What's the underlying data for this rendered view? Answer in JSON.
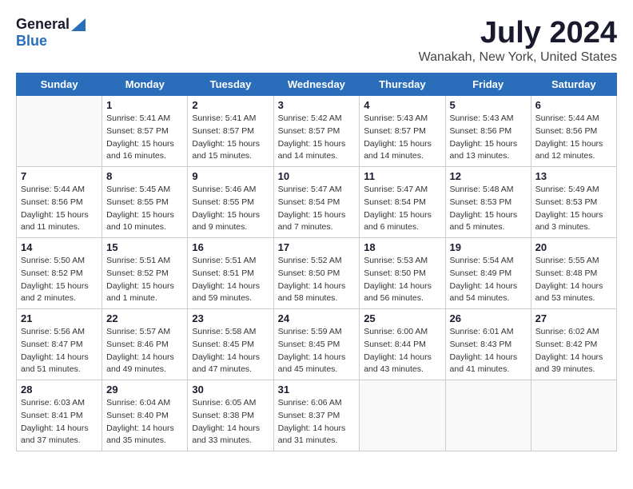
{
  "logo": {
    "general": "General",
    "blue": "Blue"
  },
  "title": "July 2024",
  "subtitle": "Wanakah, New York, United States",
  "header_days": [
    "Sunday",
    "Monday",
    "Tuesday",
    "Wednesday",
    "Thursday",
    "Friday",
    "Saturday"
  ],
  "weeks": [
    [
      {
        "day": "",
        "info": ""
      },
      {
        "day": "1",
        "info": "Sunrise: 5:41 AM\nSunset: 8:57 PM\nDaylight: 15 hours\nand 16 minutes."
      },
      {
        "day": "2",
        "info": "Sunrise: 5:41 AM\nSunset: 8:57 PM\nDaylight: 15 hours\nand 15 minutes."
      },
      {
        "day": "3",
        "info": "Sunrise: 5:42 AM\nSunset: 8:57 PM\nDaylight: 15 hours\nand 14 minutes."
      },
      {
        "day": "4",
        "info": "Sunrise: 5:43 AM\nSunset: 8:57 PM\nDaylight: 15 hours\nand 14 minutes."
      },
      {
        "day": "5",
        "info": "Sunrise: 5:43 AM\nSunset: 8:56 PM\nDaylight: 15 hours\nand 13 minutes."
      },
      {
        "day": "6",
        "info": "Sunrise: 5:44 AM\nSunset: 8:56 PM\nDaylight: 15 hours\nand 12 minutes."
      }
    ],
    [
      {
        "day": "7",
        "info": "Sunrise: 5:44 AM\nSunset: 8:56 PM\nDaylight: 15 hours\nand 11 minutes."
      },
      {
        "day": "8",
        "info": "Sunrise: 5:45 AM\nSunset: 8:55 PM\nDaylight: 15 hours\nand 10 minutes."
      },
      {
        "day": "9",
        "info": "Sunrise: 5:46 AM\nSunset: 8:55 PM\nDaylight: 15 hours\nand 9 minutes."
      },
      {
        "day": "10",
        "info": "Sunrise: 5:47 AM\nSunset: 8:54 PM\nDaylight: 15 hours\nand 7 minutes."
      },
      {
        "day": "11",
        "info": "Sunrise: 5:47 AM\nSunset: 8:54 PM\nDaylight: 15 hours\nand 6 minutes."
      },
      {
        "day": "12",
        "info": "Sunrise: 5:48 AM\nSunset: 8:53 PM\nDaylight: 15 hours\nand 5 minutes."
      },
      {
        "day": "13",
        "info": "Sunrise: 5:49 AM\nSunset: 8:53 PM\nDaylight: 15 hours\nand 3 minutes."
      }
    ],
    [
      {
        "day": "14",
        "info": "Sunrise: 5:50 AM\nSunset: 8:52 PM\nDaylight: 15 hours\nand 2 minutes."
      },
      {
        "day": "15",
        "info": "Sunrise: 5:51 AM\nSunset: 8:52 PM\nDaylight: 15 hours\nand 1 minute."
      },
      {
        "day": "16",
        "info": "Sunrise: 5:51 AM\nSunset: 8:51 PM\nDaylight: 14 hours\nand 59 minutes."
      },
      {
        "day": "17",
        "info": "Sunrise: 5:52 AM\nSunset: 8:50 PM\nDaylight: 14 hours\nand 58 minutes."
      },
      {
        "day": "18",
        "info": "Sunrise: 5:53 AM\nSunset: 8:50 PM\nDaylight: 14 hours\nand 56 minutes."
      },
      {
        "day": "19",
        "info": "Sunrise: 5:54 AM\nSunset: 8:49 PM\nDaylight: 14 hours\nand 54 minutes."
      },
      {
        "day": "20",
        "info": "Sunrise: 5:55 AM\nSunset: 8:48 PM\nDaylight: 14 hours\nand 53 minutes."
      }
    ],
    [
      {
        "day": "21",
        "info": "Sunrise: 5:56 AM\nSunset: 8:47 PM\nDaylight: 14 hours\nand 51 minutes."
      },
      {
        "day": "22",
        "info": "Sunrise: 5:57 AM\nSunset: 8:46 PM\nDaylight: 14 hours\nand 49 minutes."
      },
      {
        "day": "23",
        "info": "Sunrise: 5:58 AM\nSunset: 8:45 PM\nDaylight: 14 hours\nand 47 minutes."
      },
      {
        "day": "24",
        "info": "Sunrise: 5:59 AM\nSunset: 8:45 PM\nDaylight: 14 hours\nand 45 minutes."
      },
      {
        "day": "25",
        "info": "Sunrise: 6:00 AM\nSunset: 8:44 PM\nDaylight: 14 hours\nand 43 minutes."
      },
      {
        "day": "26",
        "info": "Sunrise: 6:01 AM\nSunset: 8:43 PM\nDaylight: 14 hours\nand 41 minutes."
      },
      {
        "day": "27",
        "info": "Sunrise: 6:02 AM\nSunset: 8:42 PM\nDaylight: 14 hours\nand 39 minutes."
      }
    ],
    [
      {
        "day": "28",
        "info": "Sunrise: 6:03 AM\nSunset: 8:41 PM\nDaylight: 14 hours\nand 37 minutes."
      },
      {
        "day": "29",
        "info": "Sunrise: 6:04 AM\nSunset: 8:40 PM\nDaylight: 14 hours\nand 35 minutes."
      },
      {
        "day": "30",
        "info": "Sunrise: 6:05 AM\nSunset: 8:38 PM\nDaylight: 14 hours\nand 33 minutes."
      },
      {
        "day": "31",
        "info": "Sunrise: 6:06 AM\nSunset: 8:37 PM\nDaylight: 14 hours\nand 31 minutes."
      },
      {
        "day": "",
        "info": ""
      },
      {
        "day": "",
        "info": ""
      },
      {
        "day": "",
        "info": ""
      }
    ]
  ]
}
